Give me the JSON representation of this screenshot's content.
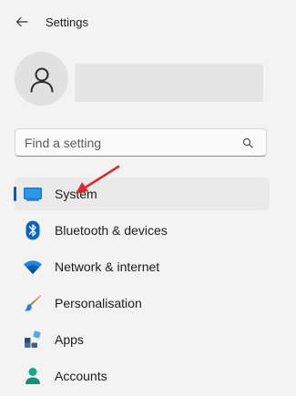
{
  "app": {
    "title": "Settings"
  },
  "search": {
    "placeholder": "Find a setting"
  },
  "nav": {
    "items": [
      {
        "label": "System",
        "icon": "system-icon",
        "selected": true
      },
      {
        "label": "Bluetooth & devices",
        "icon": "bluetooth-icon"
      },
      {
        "label": "Network & internet",
        "icon": "wifi-icon"
      },
      {
        "label": "Personalisation",
        "icon": "brush-icon"
      },
      {
        "label": "Apps",
        "icon": "apps-icon"
      },
      {
        "label": "Accounts",
        "icon": "accounts-icon"
      }
    ]
  },
  "colors": {
    "accent": "#005fb8",
    "annotation_arrow": "#d92a2a"
  }
}
